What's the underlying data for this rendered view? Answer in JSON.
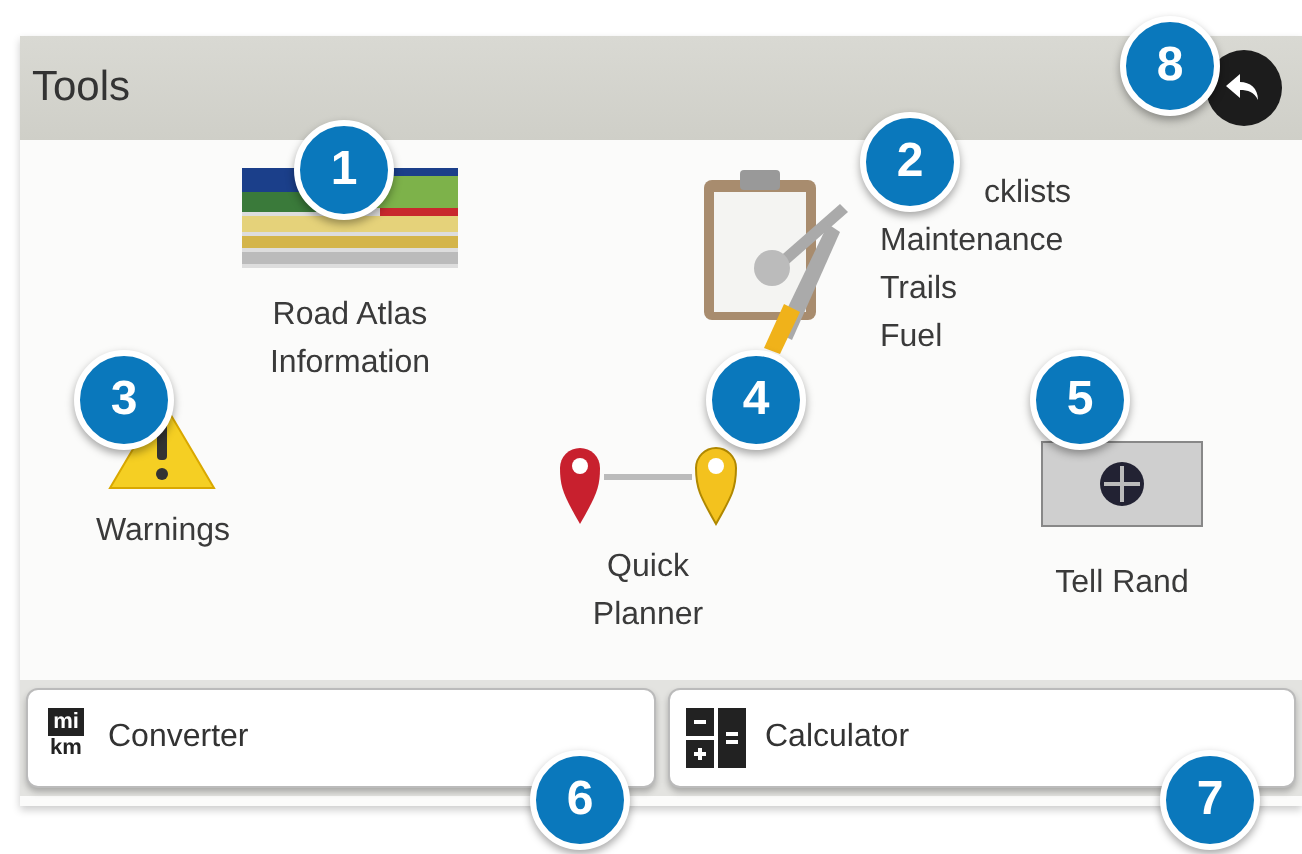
{
  "window": {
    "title": "Tools"
  },
  "tools": [
    {
      "kind": "atlas",
      "lines": [
        "Road Atlas",
        "Information"
      ]
    },
    {
      "kind": "maintenance",
      "lines": [
        "cklists",
        "Maintenance",
        "Trails",
        "Fuel"
      ]
    },
    {
      "kind": "warnings",
      "lines": [
        "Warnings"
      ]
    },
    {
      "kind": "planner",
      "lines": [
        "Quick",
        "Planner"
      ]
    },
    {
      "kind": "tellrand",
      "lines": [
        "Tell Rand"
      ]
    }
  ],
  "buttons": [
    {
      "kind": "converter",
      "label": "Converter",
      "icon_text": [
        "mi",
        "km"
      ]
    },
    {
      "kind": "calculator",
      "label": "Calculator"
    }
  ],
  "callouts": [
    "1",
    "2",
    "3",
    "4",
    "5",
    "6",
    "7",
    "8"
  ]
}
